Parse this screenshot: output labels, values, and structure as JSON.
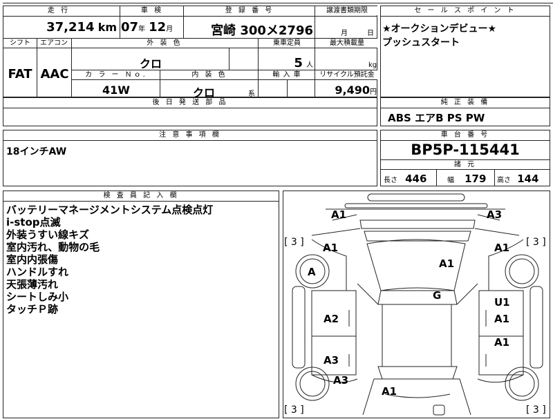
{
  "header": {
    "mileage_label": "走 行",
    "mileage_value": "37,214",
    "mileage_unit": "km",
    "shaken_label": "車 検",
    "shaken_year": "07",
    "shaken_year_unit": "年",
    "shaken_month": "12",
    "shaken_month_unit": "月",
    "registration_label": "登 録 番 号",
    "registration_value": "宮崎 300メ2796",
    "transfer_label": "譲渡書類期限",
    "transfer_month_unit": "月",
    "transfer_day_unit": "日"
  },
  "specs": {
    "shift_label": "シフト",
    "shift_value": "FAT",
    "aircon_label": "エアコン",
    "aircon_value": "AAC",
    "exterior_color_label": "外 装 色",
    "exterior_color_value": "クロ",
    "capacity_label": "乗車定員",
    "capacity_value": "5",
    "capacity_unit": "人",
    "max_load_label": "最大積載量",
    "max_load_unit": "kg",
    "color_no_label": "カ ラ ー Ｎｏ.",
    "color_no_value": "41W",
    "interior_color_label": "内 装 色",
    "interior_color_value": "クロ",
    "interior_color_unit": "系",
    "import_label": "輸 入 車",
    "recycle_label": "リサイクル預託金",
    "recycle_value": "9,490",
    "recycle_unit": "円",
    "later_parts_label": "後 日 発 送 部 品"
  },
  "selling_point": {
    "label": "セ ー ル ス ポ イ ン ト",
    "lines": [
      "★オークションデビュー★",
      "プッシュスタート"
    ]
  },
  "equipment": {
    "label": "純 正 装 備",
    "value": "ABS エアB PS PW"
  },
  "notes": {
    "label": "注 意 事 項 欄",
    "value": "18インチAW"
  },
  "chassis": {
    "label": "車 台 番 号",
    "value": "BP5P-115441"
  },
  "dimensions": {
    "label": "諸 元",
    "length_label": "長さ",
    "length_value": "446",
    "width_label": "幅",
    "width_value": "179",
    "height_label": "高さ",
    "height_value": "144"
  },
  "inspector": {
    "label": "検 査 員 記 入 欄",
    "lines": [
      "バッテリーマネージメントシステム点検点灯",
      "i-stop点滅",
      "外装うすい線キズ",
      "室内汚れ、動物の毛",
      "室内内張傷",
      "ハンドルすれ",
      "天張薄汚れ",
      "シートしみ小",
      "タッチＰ跡"
    ]
  },
  "diagram": {
    "marks": {
      "front_left_corner": "A1",
      "front_right_corner": "A3",
      "left_fender": "A1",
      "right_fender": "A1",
      "left_front_wheel": "A",
      "hood": "A1",
      "roof": "G",
      "right_front_door_u": "U1",
      "right_front_door": "A1",
      "left_front_door": "A2",
      "right_rear_door": "A1",
      "left_rear_door": "A3",
      "left_rear_quarter": "A3",
      "trunk": "A1"
    },
    "tread": {
      "front_left": "3",
      "front_right": "3",
      "rear_left": "3",
      "rear_right": "3"
    }
  }
}
